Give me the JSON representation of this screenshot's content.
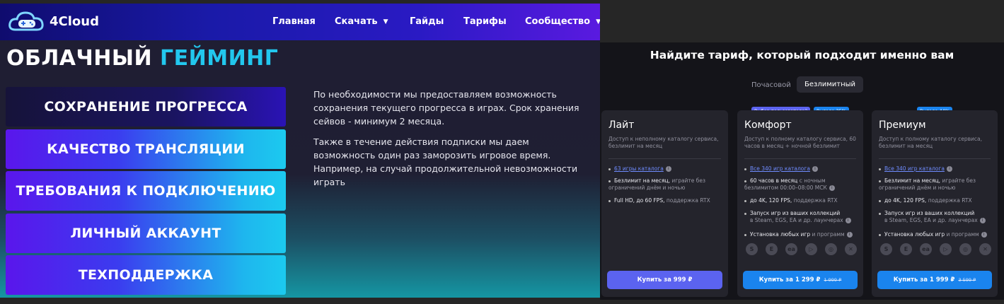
{
  "header": {
    "logo_text": "4Cloud",
    "nav": [
      {
        "label": "Главная",
        "has_dropdown": false
      },
      {
        "label": "Скачать",
        "has_dropdown": true
      },
      {
        "label": "Гайды",
        "has_dropdown": false
      },
      {
        "label": "Тарифы",
        "has_dropdown": false
      },
      {
        "label": "Сообщество",
        "has_dropdown": true
      }
    ]
  },
  "hero": {
    "title_part1": "ОБЛАЧНЫЙ",
    "title_part2": "ГЕЙМИНГ",
    "accent_color": "#22c7ee"
  },
  "menu": [
    {
      "label": "СОХРАНЕНИЕ ПРОГРЕССА",
      "active": true
    },
    {
      "label": "КАЧЕСТВО ТРАНСЛЯЦИИ",
      "active": false
    },
    {
      "label": "ТРЕБОВАНИЯ К ПОДКЛЮЧЕНИЮ",
      "active": false
    },
    {
      "label": "ЛИЧНЫЙ АККАУНТ",
      "active": false
    },
    {
      "label": "ТЕХПОДДЕРЖКА",
      "active": false
    }
  ],
  "content": {
    "paragraph1": "По необходимости мы предоставляем возможность сохранения текущего прогресса в играх. Срок хранения сейвов - минимум 2 месяца.",
    "paragraph2": "Также в течение действия подписки мы даем возможность один раз заморозить игровое время. Например, на случай продолжительной невозможности играть"
  },
  "pricing": {
    "title": "Найдите тариф, который подходит именно вам",
    "tabs": [
      {
        "label": "Почасовой",
        "selected": false
      },
      {
        "label": "Безлимитный",
        "selected": true
      }
    ],
    "plans": [
      {
        "name": "Лайт",
        "badges": [],
        "description": "Доступ к неполному каталогу сервиса, безлимит на месяц",
        "features": [
          {
            "main": "63 игры каталога",
            "sub": "",
            "link": true,
            "info": true
          },
          {
            "main": "Безлимит на месяц,",
            "sub": "играйте без ограничений днём и ночью",
            "link": false,
            "info": false
          },
          {
            "main": "Full HD, до 60 FPS,",
            "sub": "поддержка RTX",
            "link": false,
            "info": false
          }
        ],
        "button": "Купить за 999 ₽",
        "old_price": "",
        "button_color": "#5b63f0"
      },
      {
        "name": "Комфорт",
        "badges": [
          {
            "text": "Выбор пользователей",
            "color": "#5b63f0"
          },
          {
            "text": "Выгода 35%",
            "color": "#1a84ee"
          }
        ],
        "description": "Доступ к полному каталогу сервиса, 60 часов в месяц + ночной безлимит",
        "features": [
          {
            "main": "Все 340 игр каталога",
            "sub": "",
            "link": true,
            "info": true
          },
          {
            "main": "60 часов в месяц",
            "sub": "с ночным безлимитом 00:00–08:00 МСК",
            "link": false,
            "info": true
          },
          {
            "main": "до 4K, 120 FPS,",
            "sub": "поддержка RTX",
            "link": false,
            "info": false
          },
          {
            "main": "Запуск игр из ваших коллекций",
            "sub": "в Steam, EGS, EA и др. лаунчерах",
            "link": false,
            "info": true
          },
          {
            "main": "Установка любых игр",
            "sub": "и программ",
            "link": false,
            "info": true
          }
        ],
        "button": "Купить за 1 299 ₽",
        "old_price": "1 999 ₽",
        "button_color": "#1a84ee"
      },
      {
        "name": "Премиум",
        "badges": [
          {
            "text": "Выгода 44%",
            "color": "#1a84ee"
          }
        ],
        "description": "Доступ к полному каталогу сервиса, безлимит на месяц",
        "features": [
          {
            "main": "Все 340 игр каталога",
            "sub": "",
            "link": true,
            "info": true
          },
          {
            "main": "Безлимит на месяц,",
            "sub": "играйте без ограничений днём и ночью",
            "link": false,
            "info": false
          },
          {
            "main": "до 4K, 120 FPS,",
            "sub": "поддержка RTX",
            "link": false,
            "info": false
          },
          {
            "main": "Запуск игр из ваших коллекций",
            "sub": "в Steam, EGS, EA и др. лаунчерах",
            "link": false,
            "info": true
          },
          {
            "main": "Установка любых игр",
            "sub": "и программ",
            "link": false,
            "info": true
          }
        ],
        "button": "Купить за 1 999 ₽",
        "old_price": "3 599 ₽",
        "button_color": "#1a84ee"
      }
    ],
    "launcher_icons": [
      "steam-icon",
      "epic-games-icon",
      "ea-icon",
      "google-play-icon",
      "ubisoft-icon",
      "xbox-icon"
    ]
  }
}
